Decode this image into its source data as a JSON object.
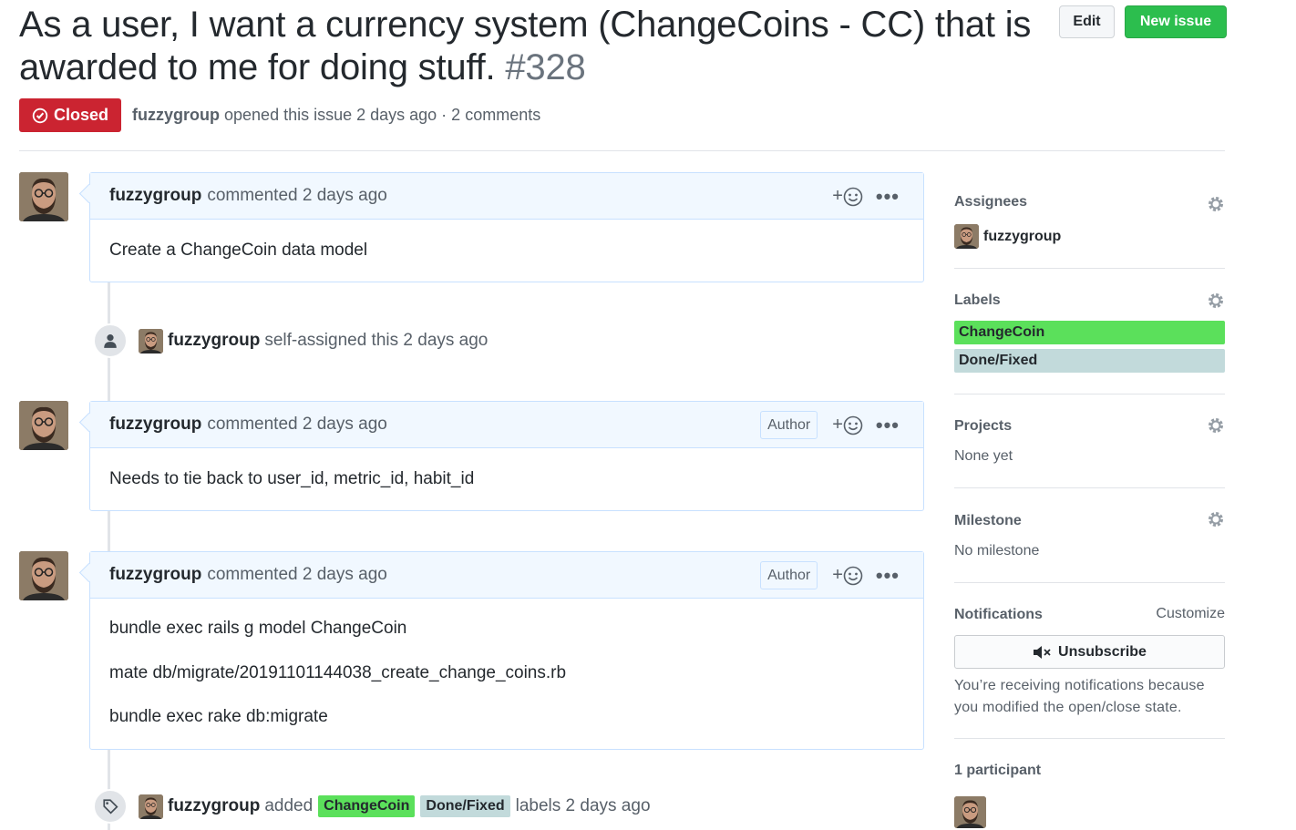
{
  "issue": {
    "title": "As a user, I want a currency system (ChangeCoins - CC) that is awarded to me for doing stuff.",
    "number": "#328",
    "state": "Closed",
    "author": "fuzzygroup",
    "opened_text": "opened this issue 2 days ago · 2 comments"
  },
  "header": {
    "edit_label": "Edit",
    "new_issue_label": "New issue"
  },
  "timeline": {
    "comments": [
      {
        "author": "fuzzygroup",
        "action": "commented 2 days ago",
        "badge": "",
        "lines": [
          "Create a ChangeCoin data model"
        ]
      },
      {
        "author": "fuzzygroup",
        "action": "commented 2 days ago",
        "badge": "Author",
        "lines": [
          "Needs to tie back to user_id, metric_id, habit_id"
        ]
      },
      {
        "author": "fuzzygroup",
        "action": "commented 2 days ago",
        "badge": "Author",
        "lines": [
          "bundle exec rails g model ChangeCoin",
          "mate db/migrate/20191101144038_create_change_coins.rb",
          "bundle exec rake db:migrate"
        ]
      }
    ],
    "assign_event": {
      "actor": "fuzzygroup",
      "text": "self-assigned this 2 days ago"
    },
    "label_event": {
      "actor": "fuzzygroup",
      "verb": "added",
      "labels": [
        "ChangeCoin",
        "Done/Fixed"
      ],
      "suffix": "labels 2 days ago"
    }
  },
  "reaction_plus": "+",
  "sidebar": {
    "assignees": {
      "heading": "Assignees",
      "user": "fuzzygroup"
    },
    "labels": {
      "heading": "Labels",
      "items": [
        {
          "name": "ChangeCoin",
          "color": "#5be05b"
        },
        {
          "name": "Done/Fixed",
          "color": "#c2dadb"
        }
      ]
    },
    "projects": {
      "heading": "Projects",
      "value": "None yet"
    },
    "milestone": {
      "heading": "Milestone",
      "value": "No milestone"
    },
    "notifications": {
      "heading": "Notifications",
      "customize": "Customize",
      "button": "Unsubscribe",
      "reason": "You’re receiving notifications because you modified the open/close state."
    },
    "participants": {
      "heading": "1 participant"
    }
  },
  "colors": {
    "closed": "#cb2431",
    "new_issue": "#2cbe4e",
    "comment_border": "#c8e1ff",
    "comment_header": "#f1f8ff"
  }
}
